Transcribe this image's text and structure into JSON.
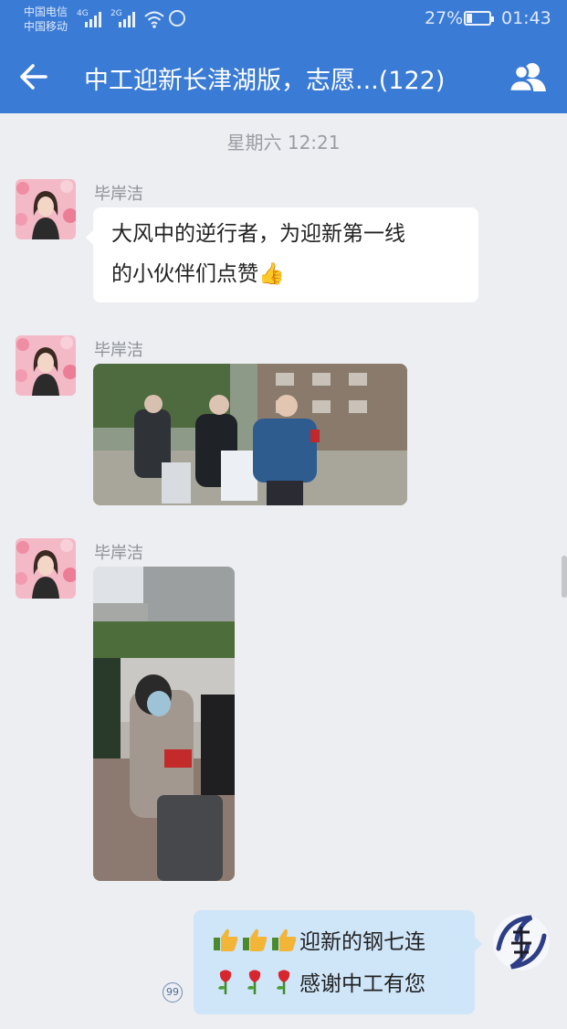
{
  "status_bar": {
    "carrier_1": "中国电信",
    "carrier_2": "中国移动",
    "network_1": "4G",
    "network_2": "2G",
    "battery_percent": "27%",
    "battery_level": 0.27,
    "time": "01:43"
  },
  "header": {
    "title": "中工迎新长津湖版，志愿...(122)",
    "back_icon": "arrow-left-icon",
    "members_icon": "group-members-icon"
  },
  "chat": {
    "timestamp": "星期六  12:21",
    "messages": [
      {
        "sender": "毕岸洁",
        "type": "text",
        "lines": [
          "大风中的逆行者，为迎新第一线",
          "的小伙伴们点赞👍"
        ]
      },
      {
        "sender": "毕岸洁",
        "type": "image",
        "description": "photo-volunteers-with-luggage"
      },
      {
        "sender": "毕岸洁",
        "type": "image",
        "description": "photo-volunteer-with-suitcase"
      }
    ],
    "outgoing": {
      "line1": "迎新的钢七连",
      "line2": "感谢中工有您",
      "line1_emoji": "thumbs-up-icon",
      "line2_emoji": "rose-icon",
      "read_count": "99"
    }
  },
  "colors": {
    "header_blue": "#3a7bd6",
    "chat_background": "#eceef2",
    "outgoing_bubble": "#cfe5f8",
    "incoming_bubble": "#ffffff"
  }
}
